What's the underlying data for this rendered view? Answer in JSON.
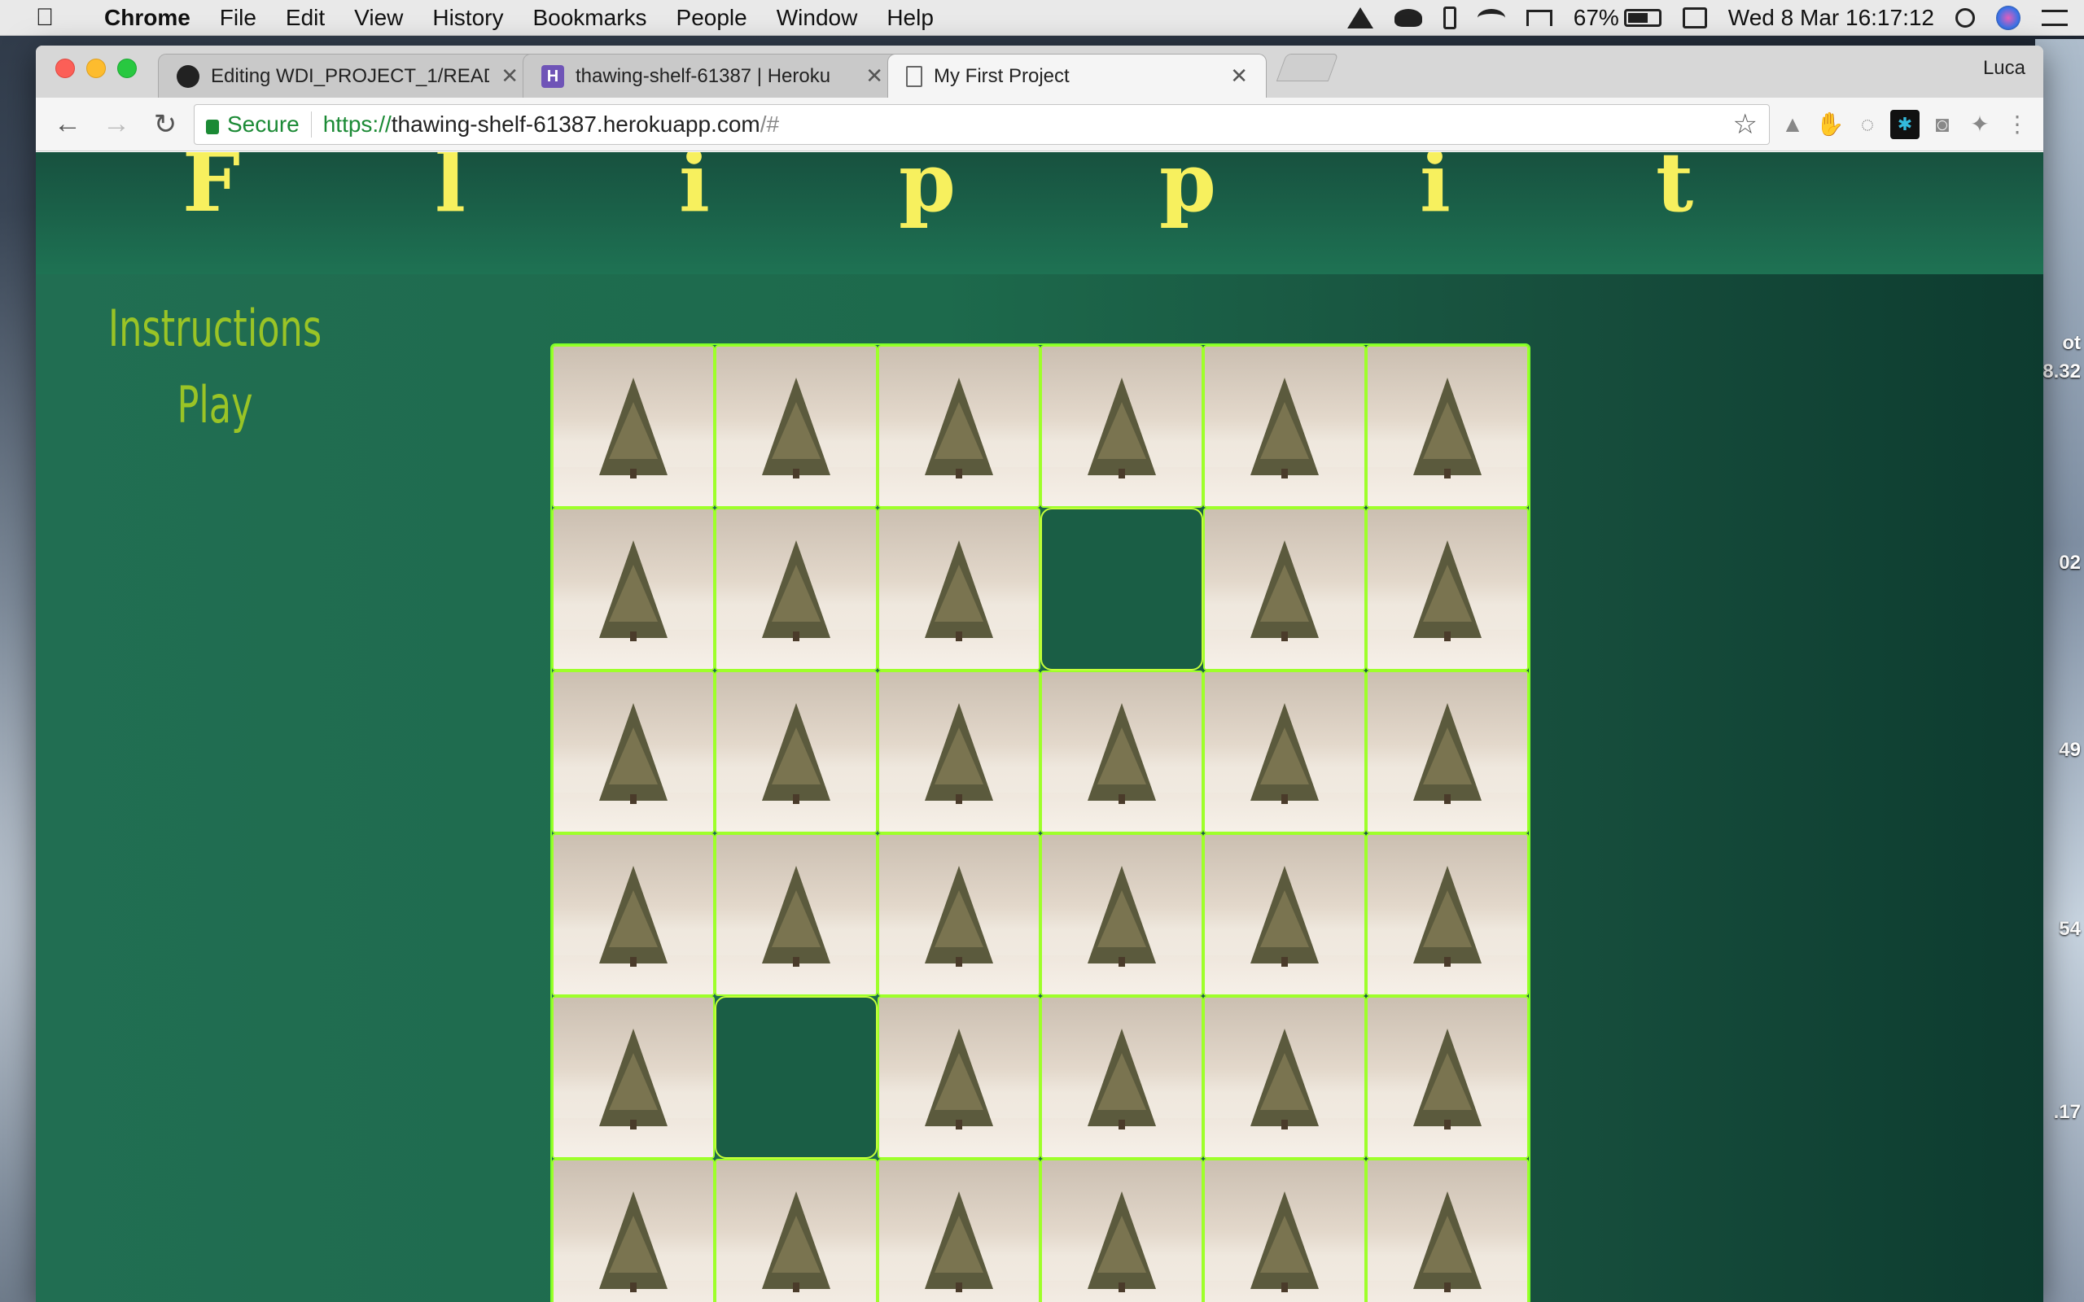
{
  "menubar": {
    "app": "Chrome",
    "items": [
      "File",
      "Edit",
      "View",
      "History",
      "Bookmarks",
      "People",
      "Window",
      "Help"
    ],
    "battery": "67%",
    "battery_level": 0.67,
    "clock": "Wed 8 Mar  16:17:12"
  },
  "browser": {
    "tabs": [
      {
        "title": "Editing WDI_PROJECT_1/READ",
        "favicon": "github-icon"
      },
      {
        "title": "thawing-shelf-61387 | Heroku",
        "favicon": "heroku-icon"
      },
      {
        "title": "My First Project",
        "favicon": "document-icon"
      }
    ],
    "profile": "Luca",
    "secure_label": "Secure",
    "url": {
      "scheme": "https://",
      "host": "thawing-shelf-61387.herokuapp.com",
      "path": "/#"
    }
  },
  "desktop_labels": [
    "ot",
    "8.32",
    "02",
    "49",
    "54",
    ".17"
  ],
  "page": {
    "title_letters": [
      "F",
      "l",
      "i",
      "p",
      "p",
      "i",
      "t"
    ],
    "menu": {
      "instructions": "Instructions",
      "play": "Play"
    },
    "board": {
      "rows": 6,
      "cols": 6,
      "empty_cells": [
        [
          1,
          3
        ],
        [
          4,
          1
        ]
      ],
      "card_image": "christmas-tree-snow"
    }
  },
  "colors": {
    "page_bg": "#1d6a4c",
    "title_letters": "#f7f05e",
    "menu_text": "#9ac426",
    "card_border": "#9eff2a"
  }
}
